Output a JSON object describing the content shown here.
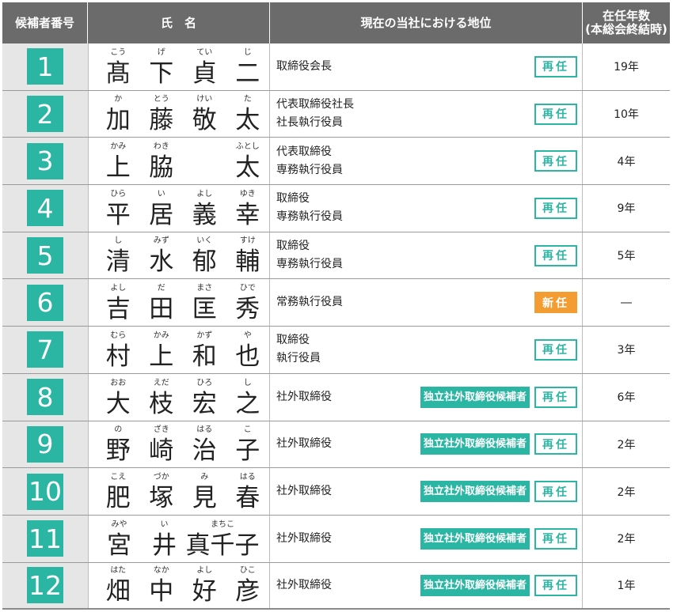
{
  "header": {
    "num": "候補者番号",
    "name": "氏　名",
    "position": "現在の当社における地位",
    "term_line1": "在任年数",
    "term_line2": "(本総会終結時)"
  },
  "colors": {
    "teal": "#2bb5a3",
    "orange": "#f39c32",
    "header_bg": "#6b6b6b",
    "num_bg": "#e6e6e6"
  },
  "candidates": [
    {
      "num": "1",
      "name": [
        [
          "こう",
          "髙"
        ],
        [
          "げ",
          "下"
        ],
        [
          "てい",
          "貞"
        ],
        [
          "じ",
          "二"
        ]
      ],
      "pos1": "取締役会長",
      "pos2": "",
      "independent": "",
      "status": "再任",
      "status_type": "re",
      "term": "19年"
    },
    {
      "num": "2",
      "name": [
        [
          "か",
          "加"
        ],
        [
          "とう",
          "藤"
        ],
        [
          "けい",
          "敬"
        ],
        [
          "た",
          "太"
        ]
      ],
      "pos1": "代表取締役社長",
      "pos2": "社長執行役員",
      "independent": "",
      "status": "再任",
      "status_type": "re",
      "term": "10年"
    },
    {
      "num": "3",
      "name": [
        [
          "かみ",
          "上"
        ],
        [
          "わき",
          "脇"
        ],
        [
          "",
          ""
        ],
        [
          "ふとし",
          "太"
        ]
      ],
      "pos1": "代表取締役",
      "pos2": "専務執行役員",
      "independent": "",
      "status": "再任",
      "status_type": "re",
      "term": "4年"
    },
    {
      "num": "4",
      "name": [
        [
          "ひら",
          "平"
        ],
        [
          "い",
          "居"
        ],
        [
          "よし",
          "義"
        ],
        [
          "ゆき",
          "幸"
        ]
      ],
      "pos1": "取締役",
      "pos2": "専務執行役員",
      "independent": "",
      "status": "再任",
      "status_type": "re",
      "term": "9年"
    },
    {
      "num": "5",
      "name": [
        [
          "し",
          "清"
        ],
        [
          "みず",
          "水"
        ],
        [
          "いく",
          "郁"
        ],
        [
          "すけ",
          "輔"
        ]
      ],
      "pos1": "取締役",
      "pos2": "専務執行役員",
      "independent": "",
      "status": "再任",
      "status_type": "re",
      "term": "5年"
    },
    {
      "num": "6",
      "name": [
        [
          "よし",
          "吉"
        ],
        [
          "だ",
          "田"
        ],
        [
          "まさ",
          "匡"
        ],
        [
          "ひで",
          "秀"
        ]
      ],
      "pos1": "常務執行役員",
      "pos2": "",
      "independent": "",
      "status": "新任",
      "status_type": "new",
      "term": "―"
    },
    {
      "num": "7",
      "name": [
        [
          "むら",
          "村"
        ],
        [
          "かみ",
          "上"
        ],
        [
          "かず",
          "和"
        ],
        [
          "や",
          "也"
        ]
      ],
      "pos1": "取締役",
      "pos2": "執行役員",
      "independent": "",
      "status": "再任",
      "status_type": "re",
      "term": "3年"
    },
    {
      "num": "8",
      "name": [
        [
          "おお",
          "大"
        ],
        [
          "えだ",
          "枝"
        ],
        [
          "ひろ",
          "宏"
        ],
        [
          "し",
          "之"
        ]
      ],
      "pos1": "社外取締役",
      "pos2": "",
      "independent": "独立社外取締役候補者",
      "status": "再任",
      "status_type": "re",
      "term": "6年"
    },
    {
      "num": "9",
      "name": [
        [
          "の",
          "野"
        ],
        [
          "ざき",
          "崎"
        ],
        [
          "はる",
          "治"
        ],
        [
          "こ",
          "子"
        ]
      ],
      "pos1": "社外取締役",
      "pos2": "",
      "independent": "独立社外取締役候補者",
      "status": "再任",
      "status_type": "re",
      "term": "2年"
    },
    {
      "num": "10",
      "name": [
        [
          "こえ",
          "肥"
        ],
        [
          "づか",
          "塚"
        ],
        [
          "み",
          "見"
        ],
        [
          "はる",
          "春"
        ]
      ],
      "pos1": "社外取締役",
      "pos2": "",
      "independent": "独立社外取締役候補者",
      "status": "再任",
      "status_type": "re",
      "term": "2年"
    },
    {
      "num": "11",
      "name": [
        [
          "みや",
          "宮"
        ],
        [
          "い",
          "井"
        ],
        [
          "まちこ",
          "真千子"
        ]
      ],
      "pos1": "社外取締役",
      "pos2": "",
      "independent": "独立社外取締役候補者",
      "status": "再任",
      "status_type": "re",
      "term": "2年"
    },
    {
      "num": "12",
      "name": [
        [
          "はた",
          "畑"
        ],
        [
          "なか",
          "中"
        ],
        [
          "よし",
          "好"
        ],
        [
          "ひこ",
          "彦"
        ]
      ],
      "pos1": "社外取締役",
      "pos2": "",
      "independent": "独立社外取締役候補者",
      "status": "再任",
      "status_type": "re",
      "term": "1年"
    }
  ]
}
